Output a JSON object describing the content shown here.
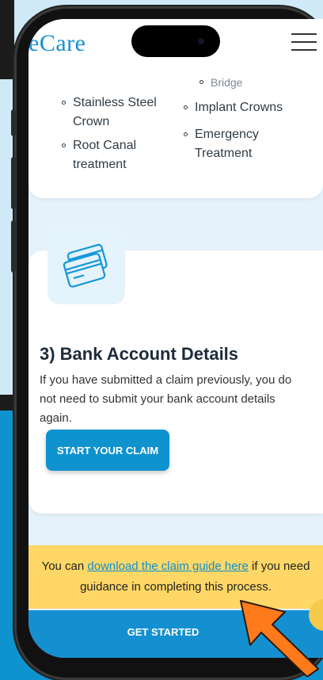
{
  "header": {
    "logo_text": "eCare",
    "menu_icon": "hamburger-menu-icon"
  },
  "services": {
    "col1": [
      "Stainless Steel Crown",
      "Root Canal treatment"
    ],
    "col2_partial": "Bridge",
    "col2": [
      "Implant Crowns",
      "Emergency Treatment"
    ]
  },
  "bank_section": {
    "icon": "credit-card-icon",
    "heading": "3) Bank Account Details",
    "paragraph": "If you have submitted a claim previously, you do not need to submit your bank account details again.",
    "button_label": "START YOUR CLAIM"
  },
  "notice": {
    "before": "You can ",
    "link": "download the claim guide here",
    "after": " if you need guidance in completing this process."
  },
  "cta": {
    "label": "GET STARTED"
  },
  "colors": {
    "brand_blue": "#0e93cf",
    "notice_yellow": "#fed766",
    "arrow_orange": "#ff7a1a"
  }
}
